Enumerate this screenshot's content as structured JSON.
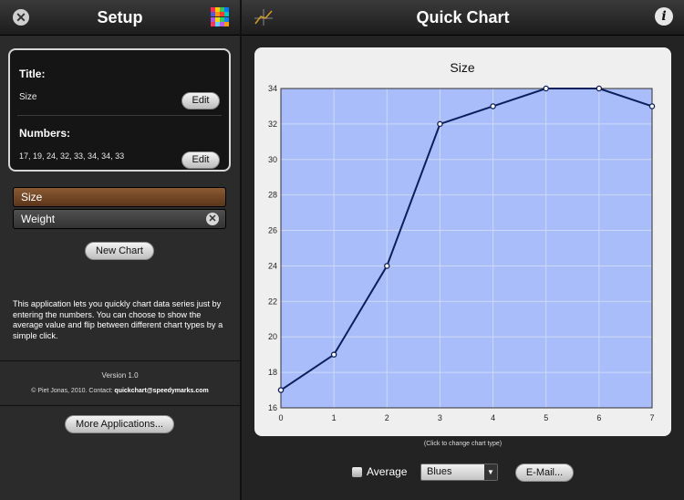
{
  "setup": {
    "title": "Setup",
    "close_glyph": "✕",
    "palette_colors": [
      "#ff2d55",
      "#ffcc00",
      "#34c759",
      "#007aff",
      "#5856d6",
      "#ff9500",
      "#ff3b30",
      "#00c7be",
      "#af52de",
      "#ffd60a",
      "#30d158",
      "#0a84ff",
      "#ff375f",
      "#64d2ff",
      "#bf5af2",
      "#ff9f0a"
    ]
  },
  "card": {
    "title_label": "Title:",
    "title_value": "Size",
    "edit_label": "Edit",
    "numbers_label": "Numbers:",
    "numbers_value": "17, 19, 24, 32, 33, 34, 34, 33"
  },
  "series": {
    "items": [
      "Size",
      "Weight"
    ],
    "delete_glyph": "✕"
  },
  "new_chart_label": "New Chart",
  "description": "This application lets you quickly chart data series just by entering the numbers. You can choose to show the average value and flip between different chart types by a simple click.",
  "version": "Version 1.0",
  "contact_prefix": "© Piet Jonas, 2010. Contact:",
  "contact_email": "quickchart@speedymarks.com",
  "more_apps_label": "More Applications...",
  "header": {
    "title": "Quick Chart",
    "info_glyph": "i"
  },
  "chart_data": {
    "type": "line",
    "title": "Size",
    "x": [
      0,
      1,
      2,
      3,
      4,
      5,
      6,
      7
    ],
    "values": [
      17,
      19,
      24,
      32,
      33,
      34,
      34,
      33
    ],
    "xlim": [
      0,
      7
    ],
    "ylim": [
      16,
      34
    ],
    "yticks": [
      16,
      18,
      20,
      22,
      24,
      26,
      28,
      30,
      32,
      34
    ],
    "grid": true,
    "colors": {
      "plot_bg": "#a8bdf9",
      "line": "#0c1f5c",
      "grid": "#cdd9fb"
    }
  },
  "chart_hint": "(Click to change chart type)",
  "controls": {
    "average_label": "Average",
    "color_scheme": "Blues",
    "email_label": "E-Mail..."
  }
}
